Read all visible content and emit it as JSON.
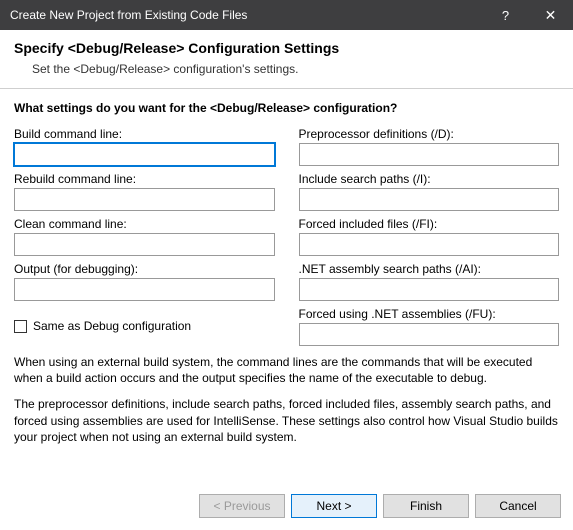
{
  "titlebar": {
    "title": "Create New Project from Existing Code Files",
    "help": "?",
    "close": "✕"
  },
  "header": {
    "title": "Specify <Debug/Release> Configuration Settings",
    "subtitle": "Set the <Debug/Release> configuration's settings."
  },
  "question": "What settings do you want for the <Debug/Release> configuration?",
  "left": {
    "build_label": "Build command line:",
    "build_value": "",
    "rebuild_label": "Rebuild command line:",
    "rebuild_value": "",
    "clean_label": "Clean command line:",
    "clean_value": "",
    "output_label": "Output (for debugging):",
    "output_value": "",
    "same_as_debug": "Same as Debug configuration"
  },
  "right": {
    "preproc_label": "Preprocessor definitions (/D):",
    "preproc_value": "",
    "include_label": "Include search paths (/I):",
    "include_value": "",
    "forced_include_label": "Forced included files (/FI):",
    "forced_include_value": "",
    "assembly_label": ".NET assembly search paths (/AI):",
    "assembly_value": "",
    "forced_using_label": "Forced using .NET assemblies (/FU):",
    "forced_using_value": ""
  },
  "info": {
    "p1": "When using an external build system, the command lines are the commands that will be executed when a build action occurs and the output specifies the name of the executable to debug.",
    "p2": "The preprocessor definitions, include search paths, forced included files, assembly search paths, and forced using assemblies are used for IntelliSense.  These settings also control how Visual Studio builds your project when not using an external build system."
  },
  "buttons": {
    "previous": "< Previous",
    "next": "Next >",
    "finish": "Finish",
    "cancel": "Cancel"
  }
}
